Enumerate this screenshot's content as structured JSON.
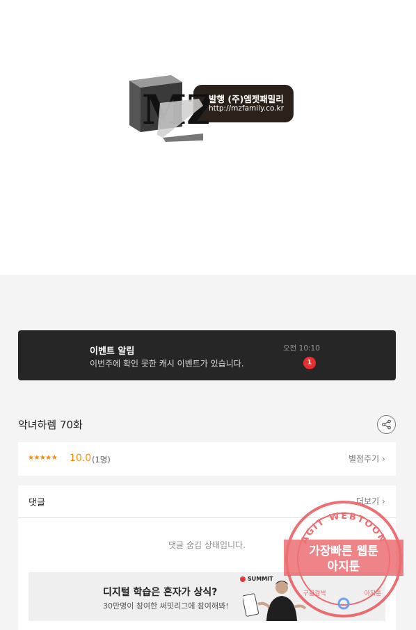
{
  "publisher": {
    "logo_text": "MZ",
    "publisher_label": "발행 (주)엠젯패밀리",
    "url": "http://mzfamily.co.kr"
  },
  "event_notice": {
    "title": "이벤트 알림",
    "message": "이번주에 확인 못한 캐시 이벤트가 있습니다.",
    "time": "오전 10:10",
    "badge_count": "1"
  },
  "episode": {
    "title": "악녀하렘 70화"
  },
  "rating": {
    "stars": "★★★★★",
    "score": "10.0",
    "count": "(1명)",
    "rate_button": "별점주기 ›"
  },
  "comments": {
    "label": "댓글",
    "more_button": "더보기 ›",
    "hidden_message": "댓글 숨김 상태입니다."
  },
  "ad": {
    "headline": "디지털 학습은 혼자가 상식?",
    "subtext": "30만명이 참여한 써밋리그에 참여해봐!",
    "brand": "SUMMIT"
  },
  "watermark": {
    "ring_text": "AGIT WEBTOON",
    "line1": "가장빠른 웹툰",
    "line2": "아지툰",
    "bottom_left": "구글검색",
    "bottom_right": "아지툰"
  },
  "colors": {
    "accent_star": "#ff8a00",
    "event_bg": "#262626",
    "badge_red": "#e62e2e",
    "watermark_red": "#e8474c"
  }
}
